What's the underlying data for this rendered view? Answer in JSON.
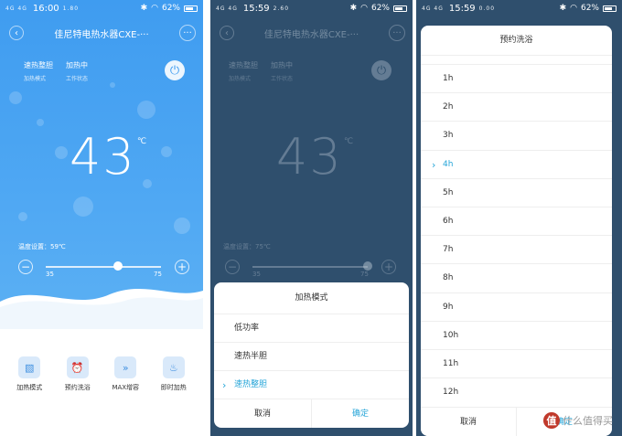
{
  "phones": [
    {
      "status": {
        "signal": "4G 4G",
        "time": "16:00",
        "speed": "1.80",
        "battery": "62%"
      },
      "title": "佳尼特电热水器CXE-···",
      "mode_label": "速热整胆",
      "mode_sub": "加热模式",
      "state_label": "加热中",
      "state_sub": "工作状态",
      "temperature": "43",
      "unit": "℃",
      "set_temp": "温度设置：59℃",
      "range_min": "35",
      "range_max": "75",
      "slider_value": 0.63,
      "modes": [
        {
          "icon": "mode-icon",
          "glyph": "▧",
          "label": "加热模式"
        },
        {
          "icon": "clock-icon",
          "glyph": "⏰",
          "label": "预约洗浴"
        },
        {
          "icon": "boost-icon",
          "glyph": "»",
          "label": "MAX增容"
        },
        {
          "icon": "heat-icon",
          "glyph": "♨",
          "label": "即时加热"
        }
      ]
    },
    {
      "status": {
        "signal": "4G 4G",
        "time": "15:59",
        "speed": "2.60",
        "battery": "62%"
      },
      "title": "佳尼特电热水器CXE-···",
      "mode_label": "速热整胆",
      "mode_sub": "加热模式",
      "state_label": "加热中",
      "state_sub": "工作状态",
      "temperature": "43",
      "unit": "℃",
      "set_temp": "温度设置：75℃",
      "range_min": "35",
      "range_max": "75",
      "slider_value": 1.0,
      "sheet": {
        "title": "加热模式",
        "options": [
          "低功率",
          "速热半胆",
          "速热整胆"
        ],
        "selected": 2,
        "cancel": "取消",
        "confirm": "确定"
      }
    },
    {
      "status": {
        "signal": "4G 4G",
        "time": "15:59",
        "speed": "0.00",
        "battery": "62%"
      },
      "sheet": {
        "title": "预约洗浴",
        "hours": [
          "1h",
          "2h",
          "3h",
          "4h",
          "5h",
          "6h",
          "7h",
          "8h",
          "9h",
          "10h",
          "11h",
          "12h"
        ],
        "selected": 3,
        "cancel": "取消",
        "confirm": "确定"
      },
      "watermark": "什么值得买",
      "watermark_badge": "值"
    }
  ],
  "colors": {
    "primary": "#3f9cf0",
    "accent": "#26a5d8",
    "overlay": "#2f4f6d"
  }
}
